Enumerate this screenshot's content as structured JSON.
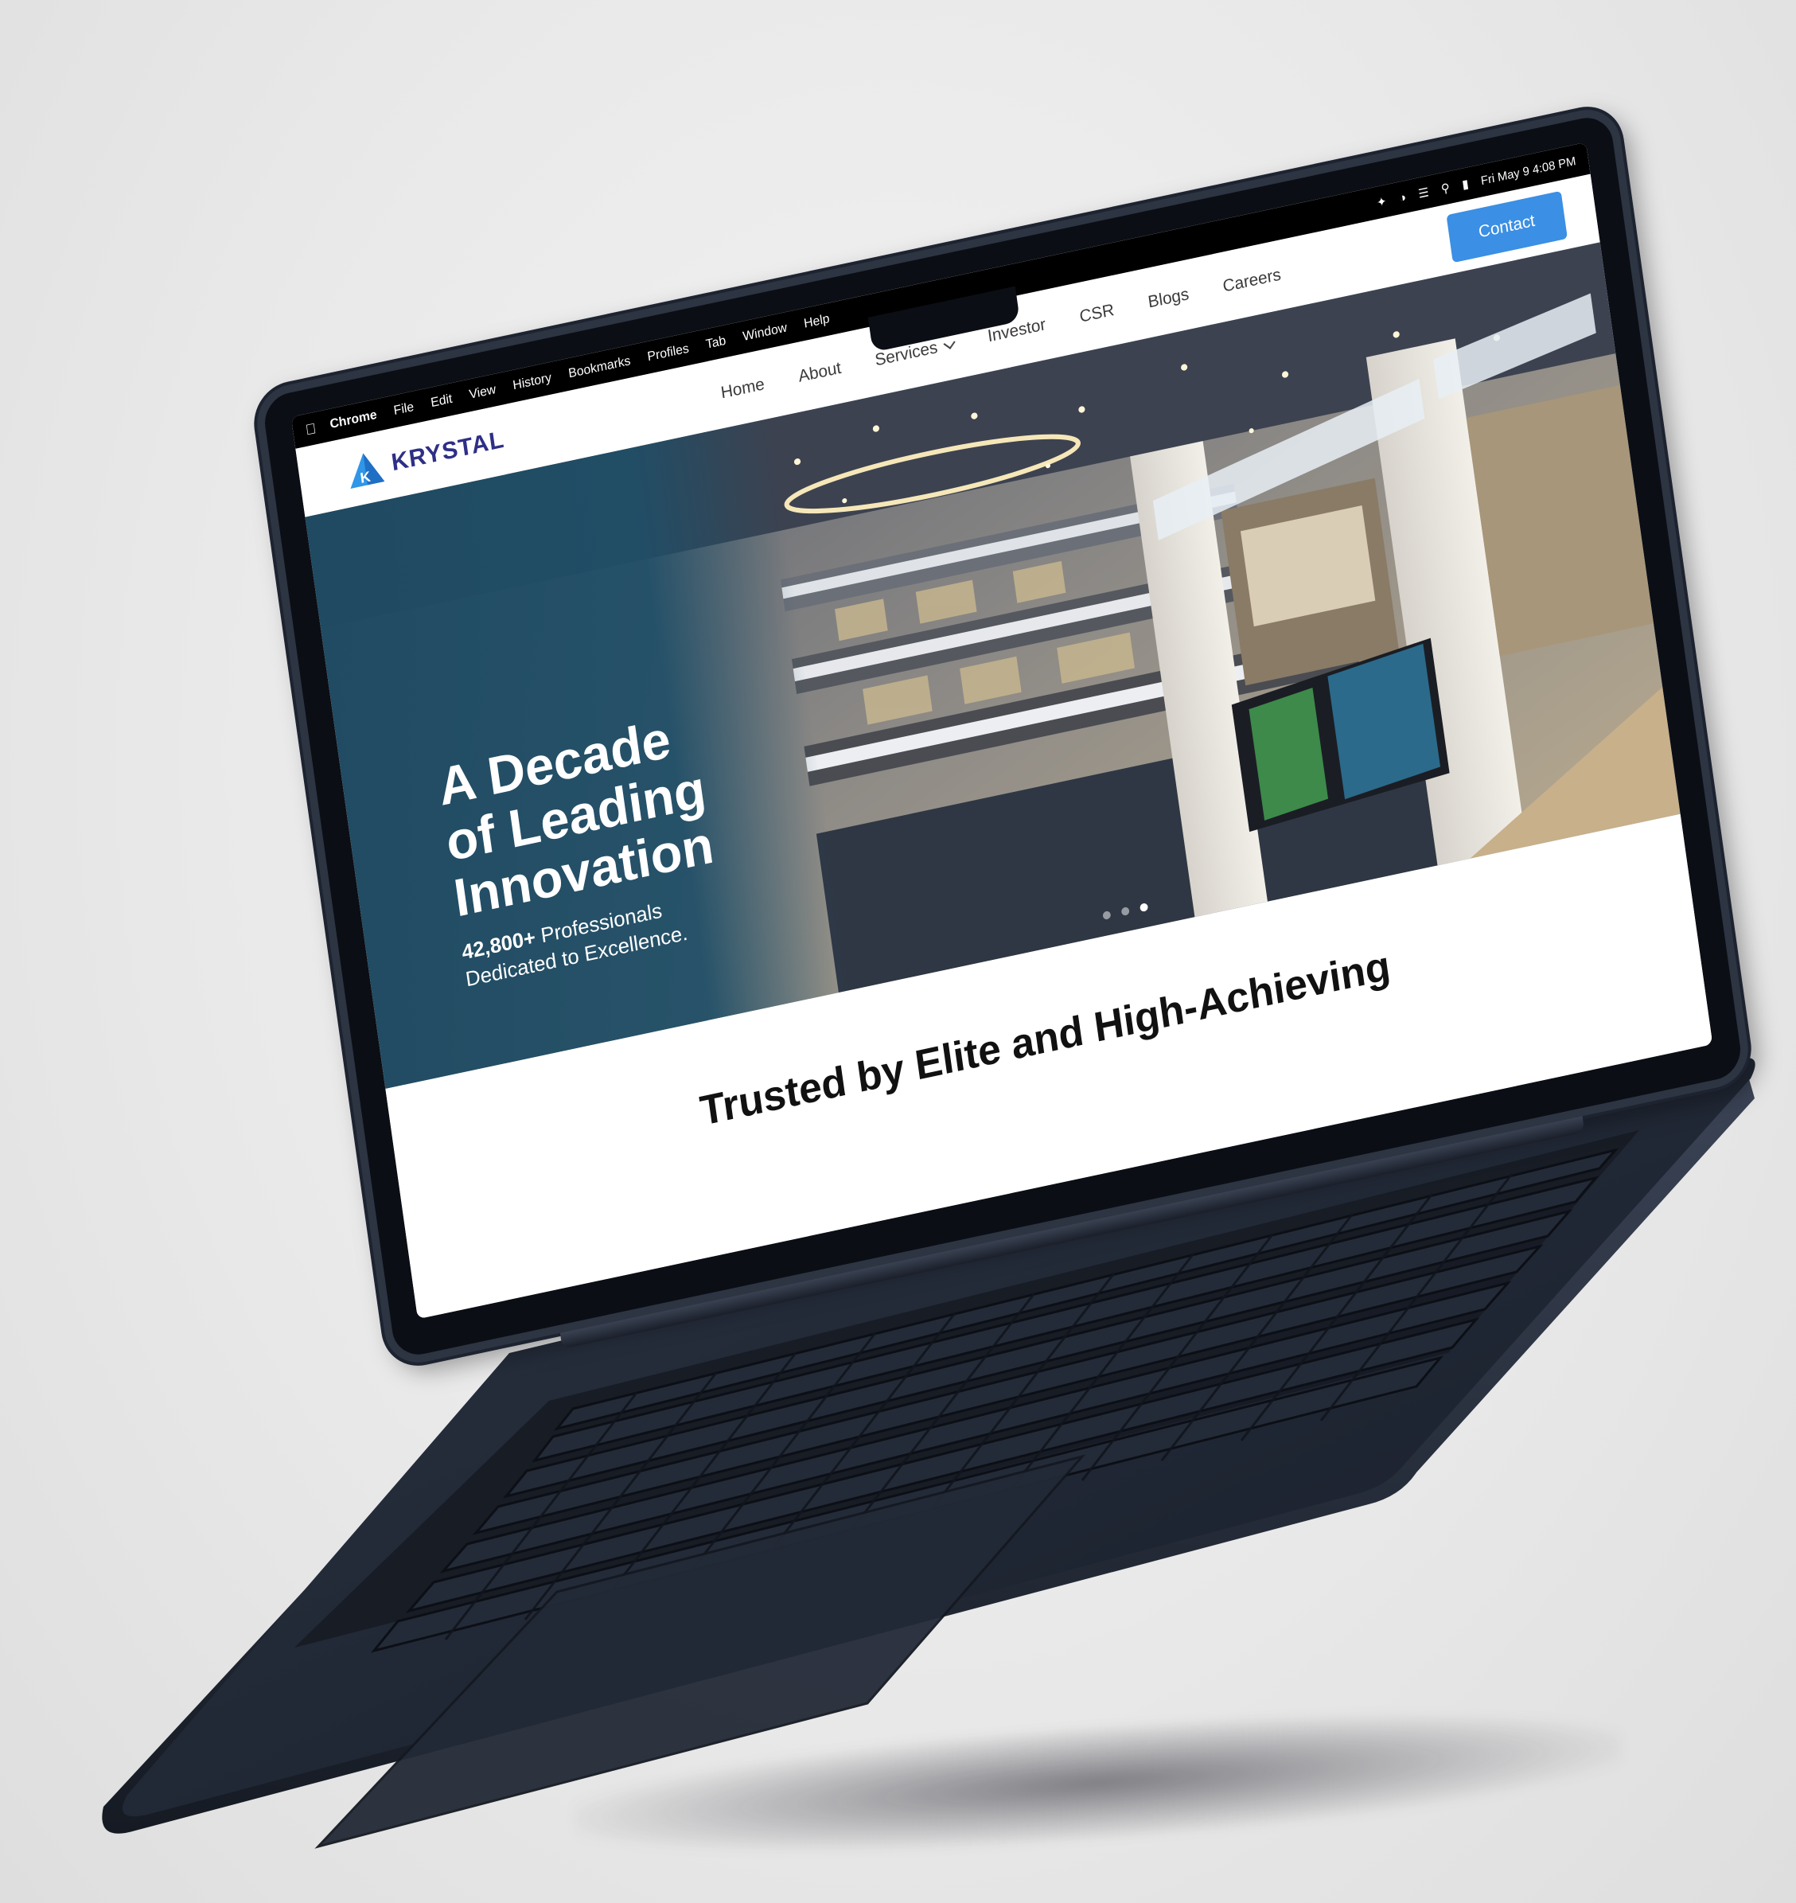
{
  "menubar": {
    "app": "Chrome",
    "items": [
      "File",
      "Edit",
      "View",
      "History",
      "Bookmarks",
      "Profiles",
      "Tab",
      "Window",
      "Help"
    ],
    "clock": "Fri May 9  4:08 PM"
  },
  "site": {
    "logo_text": "KRYSTAL",
    "nav": [
      {
        "label": "Home"
      },
      {
        "label": "About"
      },
      {
        "label": "Services"
      },
      {
        "label": "Investor"
      },
      {
        "label": "CSR"
      },
      {
        "label": "Blogs"
      },
      {
        "label": "Careers"
      }
    ],
    "contact_label": "Contact"
  },
  "hero": {
    "title_line1": "A Decade",
    "title_line2": "of Leading",
    "title_line3": "Innovation",
    "stat": "42,800+",
    "sub_rest": " Professionals",
    "sub_line2": "Dedicated to Excellence.",
    "slide_count": 3,
    "active_slide": 3
  },
  "trusted": {
    "line1": "Trusted by Elite and High-Achieving"
  },
  "colors": {
    "brand_navy": "#2e2f86",
    "accent_blue": "#3b8fe4",
    "hero_teal": "#1e4a62",
    "laptop_body": "#1f2633"
  }
}
